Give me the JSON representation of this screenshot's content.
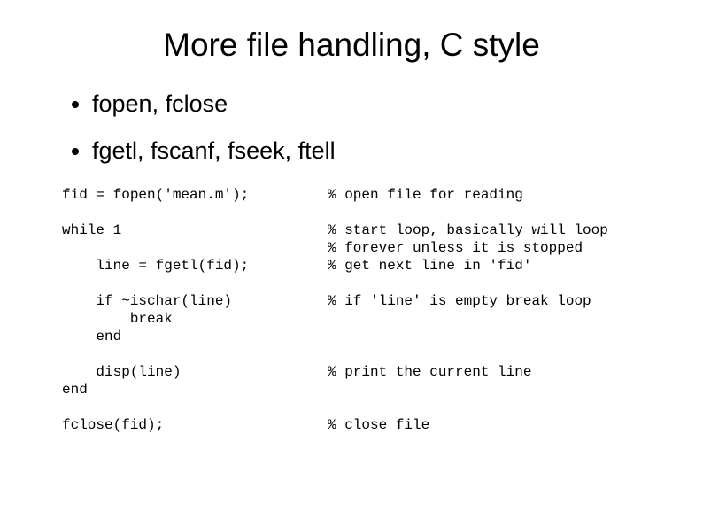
{
  "title": "More file handling, C style",
  "bullets": [
    "fopen, fclose",
    "fgetl, fscanf, fseek, ftell"
  ],
  "code": {
    "rows": [
      {
        "left": "fid = fopen('mean.m');",
        "right": "% open file for reading"
      },
      {
        "left": "while 1",
        "right": "% start loop, basically will loop"
      },
      {
        "left": "",
        "right": "% forever unless it is stopped"
      },
      {
        "left": "    line = fgetl(fid);",
        "right": "% get next line in 'fid'"
      },
      {
        "left": "    if ~ischar(line)",
        "right": "% if 'line' is empty break loop"
      },
      {
        "left": "        break",
        "right": ""
      },
      {
        "left": "    end",
        "right": ""
      },
      {
        "left": "    disp(line)",
        "right": "% print the current line"
      },
      {
        "left": "end",
        "right": ""
      },
      {
        "left": "fclose(fid);",
        "right": "% close file"
      }
    ]
  }
}
